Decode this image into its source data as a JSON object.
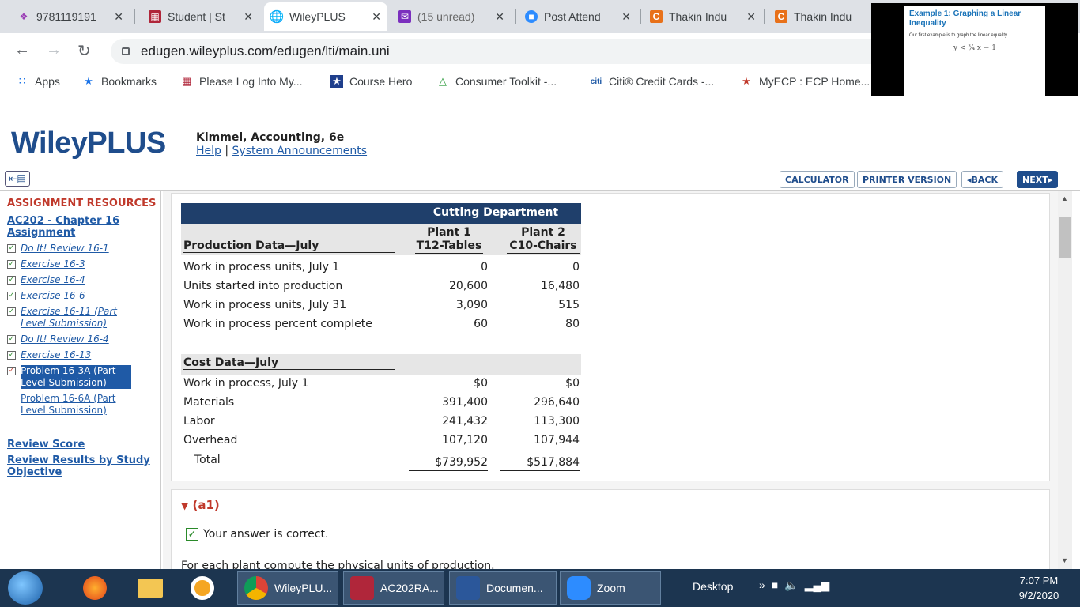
{
  "browser": {
    "tabs": [
      {
        "title": "9781119191",
        "icon": "diamond-icon"
      },
      {
        "title": "Student | St",
        "icon": "bookstore-icon"
      },
      {
        "title": "WileyPLUS",
        "icon": "globe-icon"
      },
      {
        "title": "(15 unread)",
        "icon": "mail-icon"
      },
      {
        "title": "Post Attend",
        "icon": "zoom-icon"
      },
      {
        "title": "Thakin Indu",
        "icon": "c-icon"
      },
      {
        "title": "Thakin Indu",
        "icon": "c-icon"
      }
    ],
    "url": "edugen.wileyplus.com/edugen/lti/main.uni",
    "bookmarks": [
      "Apps",
      "Bookmarks",
      "Please Log Into My...",
      "Course Hero",
      "Consumer Toolkit -...",
      "Citi® Credit Cards -...",
      "MyECP : ECP Home..."
    ]
  },
  "video_thumb": {
    "title": "Example 1: Graphing a Linear Inequality",
    "line": "Our first example is to graph the linear equality",
    "equation": "y < ¾ x − 1"
  },
  "wiley": {
    "logo": "WileyPLUS",
    "course": "Kimmel, Accounting, 6e",
    "help": "Help",
    "separator": "|",
    "announcements": "System Announcements",
    "toolbar": {
      "calculator": "CALCULATOR",
      "printer": "PRINTER VERSION",
      "back": "◂BACK",
      "next": "NEXT▸"
    }
  },
  "sidebar": {
    "heading": "ASSIGNMENT RESOURCES",
    "assignment": "AC202 - Chapter 16 Assignment",
    "items": [
      {
        "label": "Do It! Review 16-1",
        "state": "check"
      },
      {
        "label": "Exercise 16-3",
        "state": "check"
      },
      {
        "label": "Exercise 16-4",
        "state": "check"
      },
      {
        "label": "Exercise 16-6",
        "state": "check"
      },
      {
        "label": "Exercise 16-11 (Part Level Submission)",
        "state": "check"
      },
      {
        "label": "Do It! Review 16-4",
        "state": "check"
      },
      {
        "label": "Exercise 16-13",
        "state": "check"
      },
      {
        "label": "Problem 16-3A (Part Level Submission)",
        "state": "current"
      },
      {
        "label": "Problem 16-6A (Part Level Submission)",
        "state": "none"
      }
    ],
    "review_score": "Review Score",
    "review_results": "Review Results by Study Objective"
  },
  "problem": {
    "department": "Cutting Department",
    "plant1": "Plant 1",
    "plant1_sub": "T12-Tables",
    "plant2": "Plant 2",
    "plant2_sub": "C10-Chairs",
    "production_heading": "Production Data—July",
    "production_rows": [
      {
        "label": "Work in process units, July 1",
        "p1": "0",
        "p2": "0"
      },
      {
        "label": "Units started into production",
        "p1": "20,600",
        "p2": "16,480"
      },
      {
        "label": "Work in process units, July 31",
        "p1": "3,090",
        "p2": "515"
      },
      {
        "label": "Work in process percent complete",
        "p1": "60",
        "p2": "80"
      }
    ],
    "cost_heading": "Cost Data—July",
    "cost_rows": [
      {
        "label": "Work in process, July 1",
        "p1": "$0",
        "p2": "$0"
      },
      {
        "label": "Materials",
        "p1": "391,400",
        "p2": "296,640"
      },
      {
        "label": "Labor",
        "p1": "241,432",
        "p2": "113,300"
      },
      {
        "label": "Overhead",
        "p1": "107,120",
        "p2": "107,944"
      }
    ],
    "total_label": "Total",
    "total_p1": "$739,952",
    "total_p2": "$517,884"
  },
  "answer": {
    "part": "(a1)",
    "status": "Your answer is correct.",
    "prompt": "For each plant compute the physical units of production."
  },
  "taskbar": {
    "apps": [
      "WileyPLU...",
      "AC202RA...",
      "Documen...",
      "Zoom"
    ],
    "desktop": "Desktop",
    "time": "7:07 PM",
    "date": "9/2/2020"
  }
}
